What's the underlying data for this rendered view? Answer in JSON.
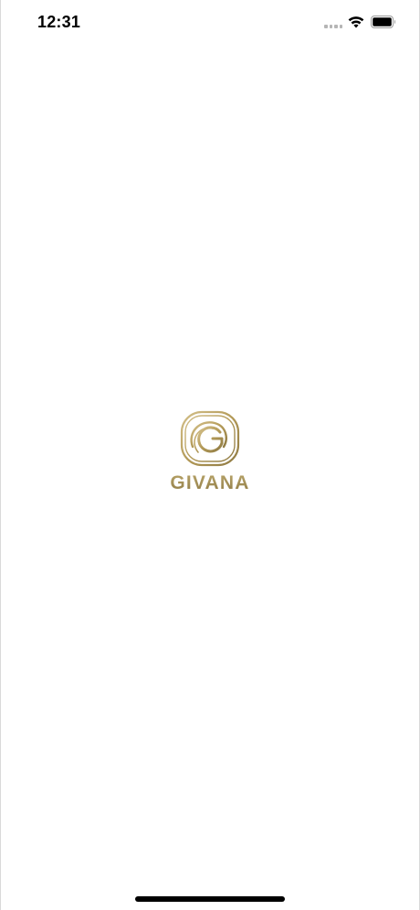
{
  "status_bar": {
    "time": "12:31"
  },
  "brand": {
    "name": "GIVANA",
    "logo_icon": "givana-g-logo-icon",
    "accent_color": "#b09a5d"
  },
  "system_icons": [
    "cellular-signal-icon",
    "wifi-icon",
    "battery-icon"
  ]
}
